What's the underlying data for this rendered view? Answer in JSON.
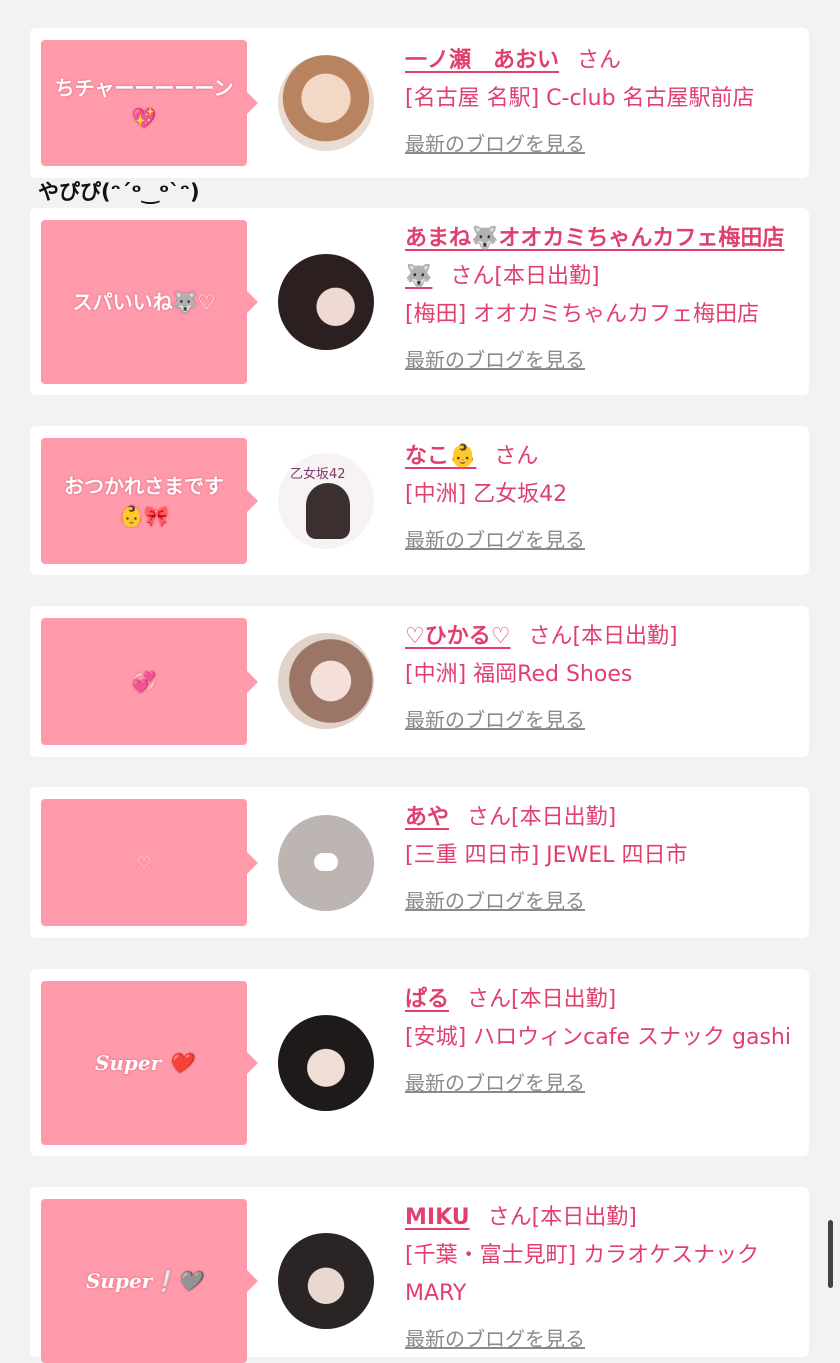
{
  "overlay_text": "やぴぴ(ᵔ´ᵒ‿ᵒ`ᵔ)",
  "cards": [
    {
      "bubble": "ちチャーーーーーン💖",
      "bubble2": "",
      "name": "一ノ瀬　あおい",
      "suffix": "さん",
      "shop": "[名古屋 名駅] C-club 名古屋駅前店",
      "blog": "最新のブログを見る",
      "avatar_color": "#d8b49a"
    },
    {
      "bubble": "スパいいね🐺♡",
      "bubble2": "",
      "name": "あまね🐺オオカミちゃんカフェ梅田店🐺",
      "suffix": "さん[本日出勤]",
      "shop": "[梅田] オオカミちゃんカフェ梅田店",
      "blog": "最新のブログを見る",
      "avatar_color": "#3d2f2e"
    },
    {
      "bubble": "おつかれさまです",
      "bubble2": "👶🎀",
      "name": "なこ👶",
      "suffix": "さん",
      "shop": "[中洲] 乙女坂42",
      "blog": "最新のブログを見る",
      "avatar_color": "#f4f0f3",
      "avatar_label": "乙女坂42"
    },
    {
      "bubble": "💞",
      "bubble2": "",
      "name": "♡ひかる♡",
      "suffix": "さん[本日出勤]",
      "shop": "[中洲] 福岡Red Shoes",
      "blog": "最新のブログを見る",
      "avatar_color": "#c9a79c"
    },
    {
      "bubble": "♡",
      "bubble2": "",
      "name": "あや",
      "suffix": "さん[本日出勤]",
      "shop": "[三重 四日市] JEWEL 四日市",
      "blog": "最新のブログを見る",
      "avatar_color": "#bbb4b1"
    },
    {
      "bubble": "Super ❤️",
      "bubble2": "",
      "name": "ぱる",
      "suffix": "さん[本日出勤]",
      "shop": "[安城] ハロウィンcafe スナック gashi",
      "blog": "最新のブログを見る",
      "avatar_color": "#5a4d4a"
    },
    {
      "bubble": "Super❕🩶",
      "bubble2": "",
      "name": "MIKU",
      "suffix": "さん[本日出勤]",
      "shop": "[千葉・富士見町] カラオケスナック MARY",
      "blog": "最新のブログを見る",
      "avatar_color": "#6b625f"
    }
  ]
}
